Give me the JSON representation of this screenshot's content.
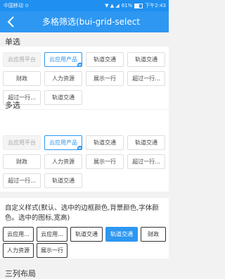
{
  "status_bar": {
    "carrier": "中国移动 ⊙",
    "signal": "▼ ▲ ◢",
    "battery_text": "61%",
    "time": "下午2:43"
  },
  "nav": {
    "title": "多格筛选(bui-grid-select"
  },
  "single": {
    "title": "单选",
    "items": [
      "云应用平台",
      "云应用产品",
      "轨道交通",
      "轨道交通",
      "财政",
      "人力资源",
      "展示一行",
      "超过一行...",
      "超过一行...",
      "轨道交通"
    ]
  },
  "multi": {
    "title": "多选",
    "items": [
      "云应用平台",
      "云应用产品",
      "轨道交通",
      "轨道交通",
      "财政",
      "人力资源",
      "展示一行",
      "超过一行...",
      "超过一行...",
      "轨道交通"
    ]
  },
  "custom": {
    "title": "自定义样式(默认、选中的边框颜色,背景颜色,字体颜色。选中的图标,宽高)",
    "items": [
      "云应用...",
      "云应用...",
      "轨道交通",
      "轨道交通",
      "财政",
      "人力资源",
      "展示一行"
    ]
  },
  "three_col": {
    "title": "三列布局"
  },
  "colors": {
    "primary": "#2d97f2",
    "status_bar": "#1f8ff0"
  }
}
